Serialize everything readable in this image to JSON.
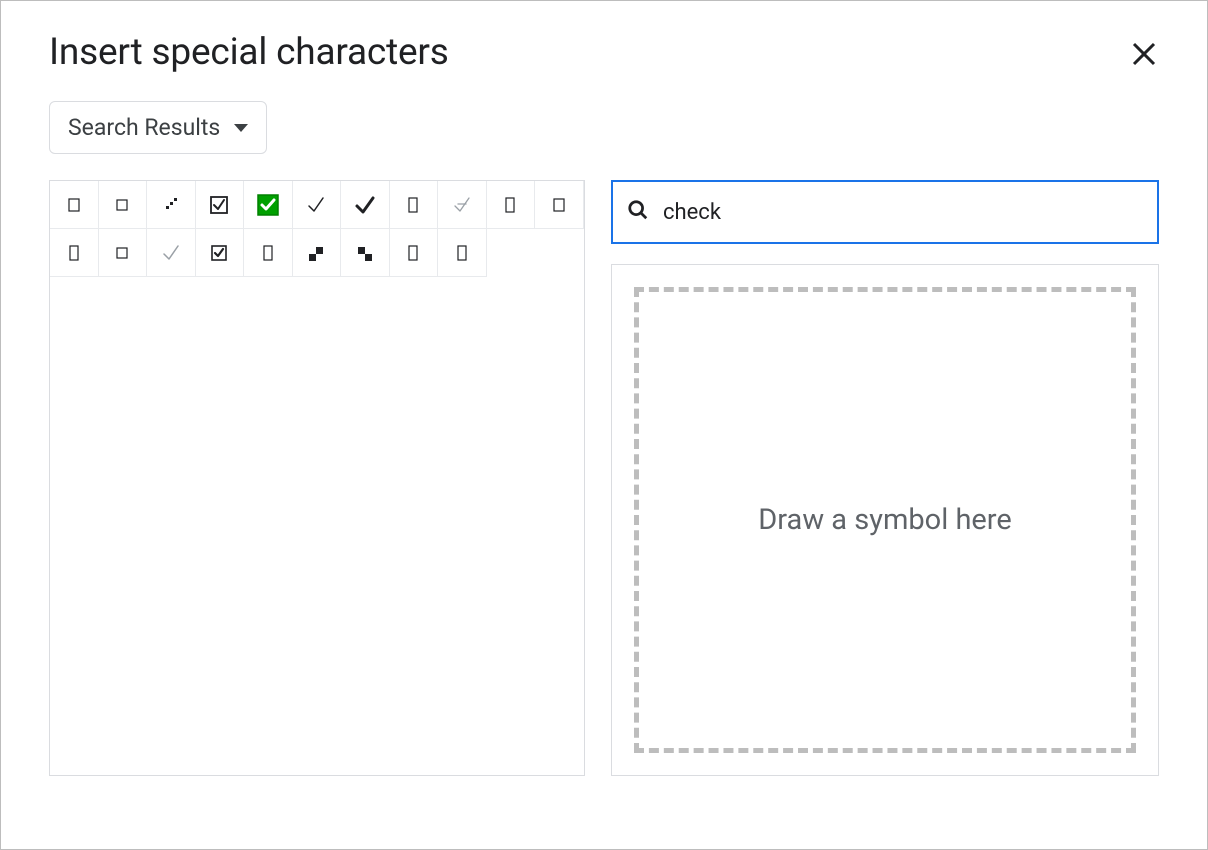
{
  "dialog": {
    "title": "Insert special characters"
  },
  "dropdown": {
    "label": "Search Results"
  },
  "search": {
    "value": "check"
  },
  "draw": {
    "placeholder": "Draw a symbol here"
  },
  "characters": [
    {
      "name": "ballot-box",
      "glyph": "☐"
    },
    {
      "name": "white-square",
      "glyph": "▢"
    },
    {
      "name": "checker-pattern",
      "glyph": "⁘"
    },
    {
      "name": "ballot-box-with-check",
      "glyph": "☑"
    },
    {
      "name": "white-heavy-check-mark",
      "glyph": "✅"
    },
    {
      "name": "check-mark",
      "glyph": "✓"
    },
    {
      "name": "heavy-check-mark",
      "glyph": "✔"
    },
    {
      "name": "square-outline",
      "glyph": "▯"
    },
    {
      "name": "not-check-mark",
      "glyph": "⍻"
    },
    {
      "name": "white-vertical-rectangle",
      "glyph": "▯"
    },
    {
      "name": "ballot-box-2",
      "glyph": "☐"
    },
    {
      "name": "white-rect",
      "glyph": "▯"
    },
    {
      "name": "white-square-2",
      "glyph": "□"
    },
    {
      "name": "light-check-mark",
      "glyph": "✓"
    },
    {
      "name": "ballot-box-with-bold-check",
      "glyph": "☑"
    },
    {
      "name": "white-rect-2",
      "glyph": "▯"
    },
    {
      "name": "checker-board",
      "glyph": "▞"
    },
    {
      "name": "checker-board-2",
      "glyph": "▚"
    },
    {
      "name": "vertical-rect",
      "glyph": "▯"
    },
    {
      "name": "vertical-rect-2",
      "glyph": "▯"
    }
  ]
}
